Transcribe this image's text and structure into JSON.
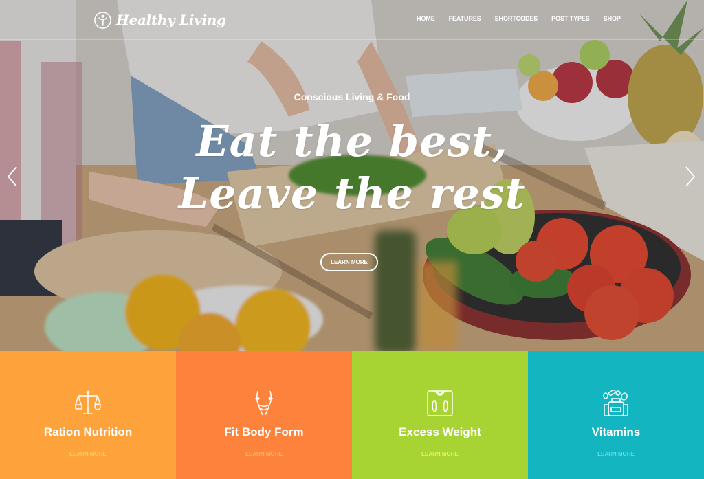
{
  "brand": {
    "name": "Healthy Living",
    "logo_icon": "person-in-circle-icon"
  },
  "nav": {
    "items": [
      "HOME",
      "FEATURES",
      "SHORTCODES",
      "POST TYPES",
      "SHOP"
    ]
  },
  "hero": {
    "kicker": "Conscious Living & Food",
    "headline_line1": "Eat the best,",
    "headline_line2": "Leave the rest",
    "button_label": "LEARN MORE",
    "prev_icon": "chevron-left-icon",
    "next_icon": "chevron-right-icon"
  },
  "features": [
    {
      "title": "Ration Nutrition",
      "link": "LEARN MORE",
      "icon": "balance-scale-icon",
      "bg": "#fea33c",
      "link_color": "#f6d35a"
    },
    {
      "title": "Fit Body Form",
      "link": "LEARN MORE",
      "icon": "body-waist-icon",
      "bg": "#fd833d",
      "link_color": "#f8b764"
    },
    {
      "title": "Excess Weight",
      "link": "LEARN MORE",
      "icon": "weight-scale-icon",
      "bg": "#a7d432",
      "link_color": "#e3f463"
    },
    {
      "title": "Vitamins",
      "link": "LEARN MORE",
      "icon": "vitamins-bottle-icon",
      "bg": "#12b5c0",
      "link_color": "#5fdde2"
    }
  ]
}
